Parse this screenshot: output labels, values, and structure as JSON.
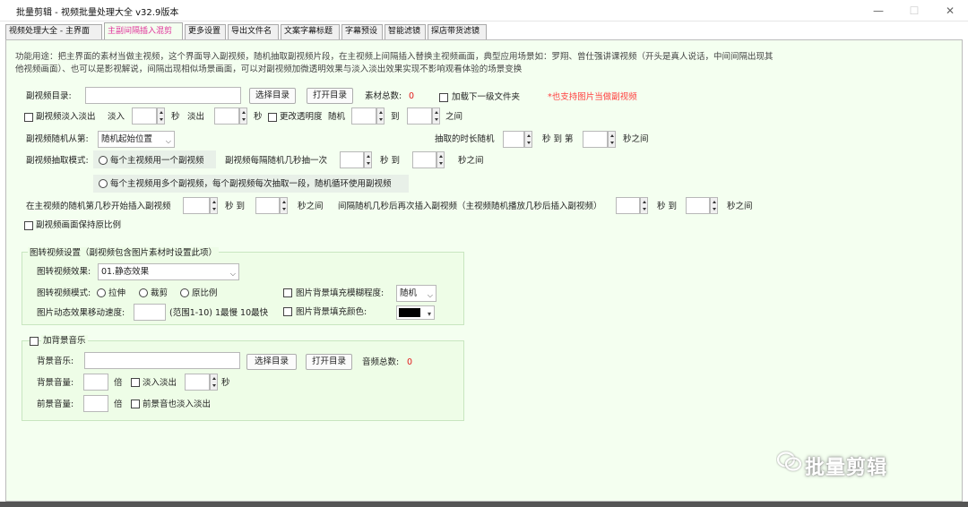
{
  "window": {
    "title": "批量剪辑 - 视频批量处理大全 v32.9版本",
    "minimize": "—",
    "maximize": "☐",
    "close": "✕"
  },
  "tabs": [
    "视频处理大全 - 主界面",
    "主副间隔插入混剪",
    "更多设置",
    "导出文件名",
    "文案字幕标题",
    "字幕预设",
    "智能滤镜",
    "探店带货滤镜"
  ],
  "desc": {
    "line1": "功能用途：把主界面的素材当做主视频，这个界面导入副视频，随机抽取副视频片段，在主视频上间隔插入替换主视频画面，典型应用场景如：罗翔、曾仕强讲课视频（开头是真人说话，中间间隔出现其",
    "line2": "他视频画面）、也可以是影视解说，间隔出现相似场景画面，可以对副视频加微透明效果与淡入淡出效果实现不影响观看体验的场景变换"
  },
  "subdir": {
    "label": "副视频目录:",
    "choose": "选择目录",
    "open": "打开目录",
    "count_label": "素材总数:",
    "count": "0",
    "include_sub": "加载下一级文件夹",
    "note": "*也支持图片当做副视频"
  },
  "fade": {
    "label": "副视频淡入淡出",
    "in": "淡入",
    "sec1": "秒",
    "out": "淡出",
    "sec2": "秒",
    "opacity": "更改透明度",
    "random": "随机",
    "to": "到",
    "between": "之间"
  },
  "random_from": {
    "label": "副视频随机从第:",
    "value": "随机起始位置",
    "dur_label": "抽取的时长随机",
    "sec_to": "秒 到 第",
    "sec_between": "秒之间"
  },
  "mode": {
    "label": "副视频抽取模式:",
    "opt1": "每个主视频用一个副视频",
    "every": "副视频每隔随机几秒抽一次",
    "sec_to": "秒 到",
    "sec_between": "秒之间",
    "opt2": "每个主视频用多个副视频，每个副视频每次抽取一段，随机循环使用副视频"
  },
  "insert": {
    "label": "在主视频的随机第几秒开始插入副视频",
    "sec_to": "秒 到",
    "sec_between": "秒之间",
    "interval": "间隔随机几秒后再次插入副视频（主视频随机播放几秒后插入副视频）",
    "sec_to2": "秒 到",
    "sec_between2": "秒之间"
  },
  "keep_ratio": "副视频画面保持原比例",
  "img": {
    "title": "图转视频设置（副视频包含图片素材时设置此项）",
    "effect_label": "图转视频效果:",
    "effect": "01.静态效果",
    "mode_label": "图转视频模式:",
    "stretch": "拉伸",
    "crop": "裁剪",
    "orig": "原比例",
    "blur_label": "图片背景填充模糊程度:",
    "blur": "随机",
    "speed_label": "图片动态效果移动速度:",
    "speed_hint": "(范围1-10) 1最慢 10最快",
    "fill_label": "图片背景填充颜色:",
    "fill_color": "#000000"
  },
  "bgm": {
    "title": "加背景音乐",
    "label": "背景音乐:",
    "choose": "选择目录",
    "open": "打开目录",
    "count_label": "音频总数:",
    "count": "0",
    "vol_label": "背景音量:",
    "times": "倍",
    "fade": "淡入淡出",
    "sec": "秒",
    "fvol_label": "前景音量:",
    "times2": "倍",
    "ffade": "前景音也淡入淡出"
  },
  "watermark": "批量剪辑"
}
